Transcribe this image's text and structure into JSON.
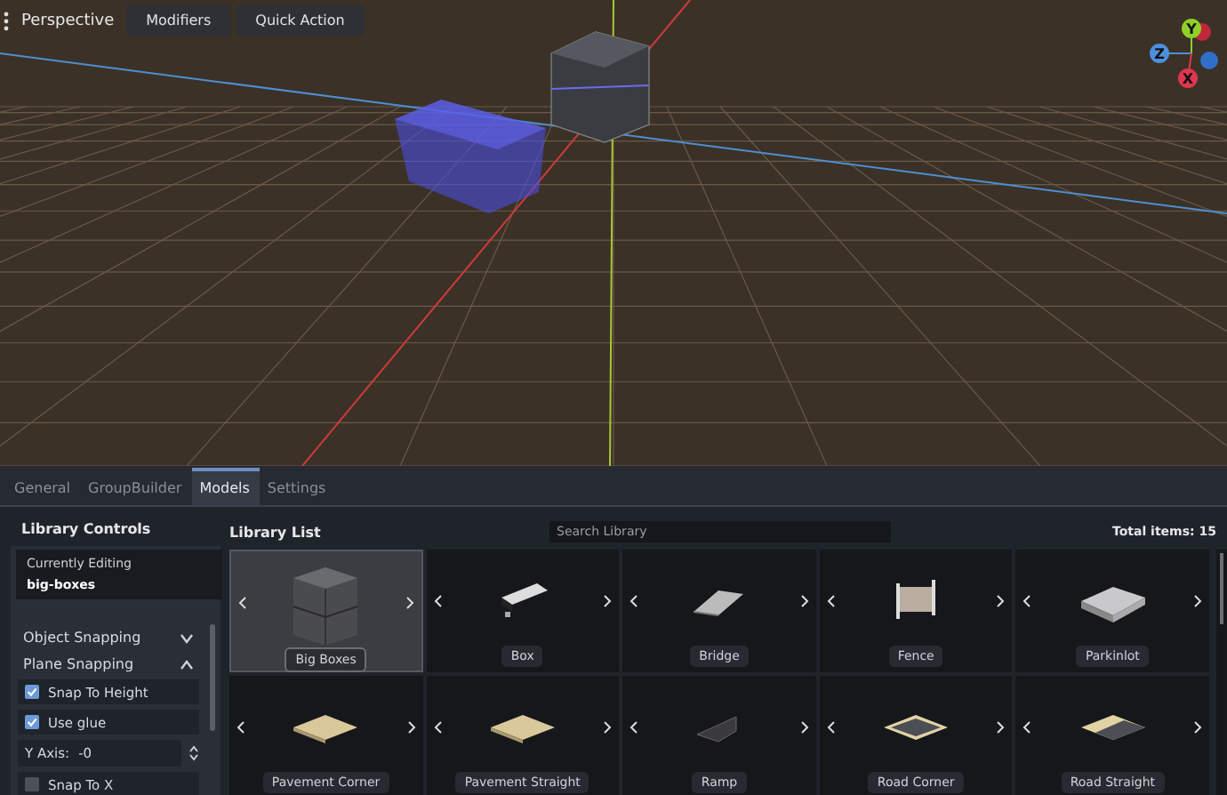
{
  "viewport": {
    "view_button": "Perspective",
    "toolbar_buttons": [
      "Modifiers",
      "Quick Action"
    ],
    "gizmo_axes": [
      "Y",
      "Z",
      "X"
    ]
  },
  "tabs": [
    {
      "label": "General",
      "selected": false
    },
    {
      "label": "GroupBuilder",
      "selected": false
    },
    {
      "label": "Models",
      "selected": true
    },
    {
      "label": "Settings",
      "selected": false
    }
  ],
  "library_controls": {
    "title": "Library Controls",
    "editing_label": "Currently Editing",
    "editing_value": "big-boxes",
    "sections": [
      {
        "label": "Object Snapping",
        "expanded": false
      },
      {
        "label": "Plane Snapping",
        "expanded": true
      }
    ],
    "options": [
      {
        "kind": "checkbox",
        "label": "Snap To Height",
        "checked": true
      },
      {
        "kind": "checkbox",
        "label": "Use glue",
        "checked": true
      },
      {
        "kind": "spinbox",
        "label": "Y Axis:",
        "value": "-0"
      },
      {
        "kind": "checkbox",
        "label": "Snap To X",
        "checked": false
      }
    ]
  },
  "library_list": {
    "title": "Library List",
    "search_placeholder": "Search Library",
    "total": "Total items: 15",
    "items": [
      {
        "name": "Big Boxes",
        "selected": true
      },
      {
        "name": "Box",
        "selected": false
      },
      {
        "name": "Bridge",
        "selected": false
      },
      {
        "name": "Fence",
        "selected": false
      },
      {
        "name": "Parkinlot",
        "selected": false
      },
      {
        "name": "Pavement Corner",
        "selected": false
      },
      {
        "name": "Pavement Straight",
        "selected": false
      },
      {
        "name": "Ramp",
        "selected": false
      },
      {
        "name": "Road Corner",
        "selected": false
      },
      {
        "name": "Road Straight",
        "selected": false
      }
    ]
  }
}
